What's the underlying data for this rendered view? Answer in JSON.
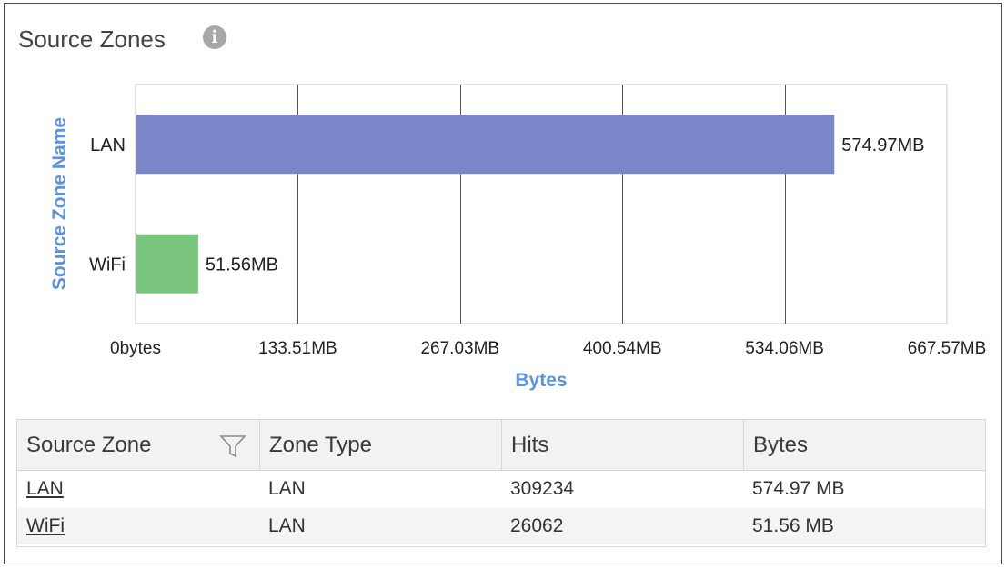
{
  "panel": {
    "title": "Source Zones"
  },
  "icons": {
    "info": "info-icon",
    "filter": "filter-icon"
  },
  "colors": {
    "lan_bar": "#7b86c9",
    "wifi_bar": "#7bc67e",
    "axis_title": "#5b93e0"
  },
  "chart_data": {
    "type": "bar",
    "orientation": "horizontal",
    "categories": [
      "LAN",
      "WiFi"
    ],
    "values": [
      574.97,
      51.56
    ],
    "value_labels": [
      "574.97MB",
      "51.56MB"
    ],
    "xlabel": "Bytes",
    "ylabel": "Source Zone Name",
    "xlim": [
      0,
      667.57
    ],
    "xticks": [
      0,
      133.51,
      267.03,
      400.54,
      534.06,
      667.57
    ],
    "xtick_labels": [
      "0bytes",
      "133.51MB",
      "267.03MB",
      "400.54MB",
      "534.06MB",
      "667.57MB"
    ],
    "grid": true
  },
  "table": {
    "columns": [
      "Source Zone",
      "Zone Type",
      "Hits",
      "Bytes"
    ],
    "rows": [
      {
        "zone": "LAN",
        "type": "LAN",
        "hits": "309234",
        "bytes": "574.97 MB"
      },
      {
        "zone": "WiFi",
        "type": "LAN",
        "hits": "26062",
        "bytes": "51.56 MB"
      }
    ]
  }
}
